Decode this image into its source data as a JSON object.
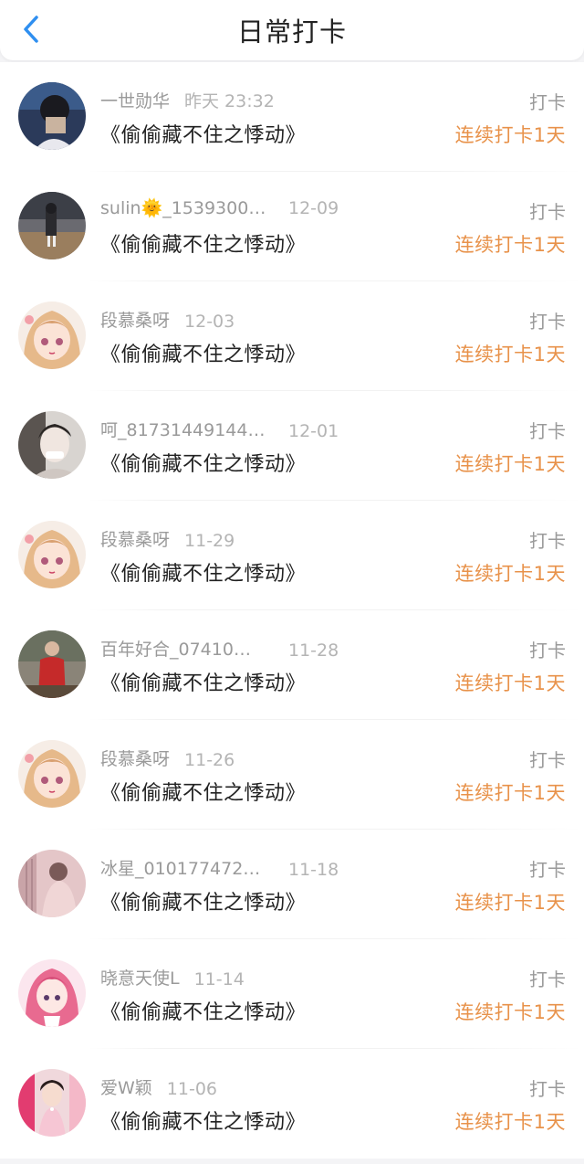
{
  "header": {
    "title": "日常打卡",
    "back_icon": "chevron-left-icon",
    "accent": "#2f8ff0"
  },
  "colors": {
    "streak": "#e8924a",
    "meta": "#9a9a9a",
    "text": "#222222"
  },
  "entries": [
    {
      "name": "一世勋华",
      "date": "昨天 23:32",
      "book": "《偷偷藏不住之悸动》",
      "action": "打卡",
      "streak": "连续打卡1天",
      "avatar": "avatar-photo-boy-icon"
    },
    {
      "name": "sulin🌞_1539300…",
      "date": "12-09",
      "book": "《偷偷藏不住之悸动》",
      "action": "打卡",
      "streak": "连续打卡1天",
      "avatar": "avatar-photo-street-icon"
    },
    {
      "name": "段慕桑呀",
      "date": "12-03",
      "book": "《偷偷藏不住之悸动》",
      "action": "打卡",
      "streak": "连续打卡1天",
      "avatar": "avatar-anime-girl-icon"
    },
    {
      "name": "呵_81731449144…",
      "date": "12-01",
      "book": "《偷偷藏不住之悸动》",
      "action": "打卡",
      "streak": "连续打卡1天",
      "avatar": "avatar-photo-girl-icon"
    },
    {
      "name": "段慕桑呀",
      "date": "11-29",
      "book": "《偷偷藏不住之悸动》",
      "action": "打卡",
      "streak": "连续打卡1天",
      "avatar": "avatar-anime-girl-icon"
    },
    {
      "name": "百年好合_07410…",
      "date": "11-28",
      "book": "《偷偷藏不住之悸动》",
      "action": "打卡",
      "streak": "连续打卡1天",
      "avatar": "avatar-photo-red-coat-icon"
    },
    {
      "name": "段慕桑呀",
      "date": "11-26",
      "book": "《偷偷藏不住之悸动》",
      "action": "打卡",
      "streak": "连续打卡1天",
      "avatar": "avatar-anime-girl-icon"
    },
    {
      "name": "冰星_010177472…",
      "date": "11-18",
      "book": "《偷偷藏不住之悸动》",
      "action": "打卡",
      "streak": "连续打卡1天",
      "avatar": "avatar-photo-pink-icon"
    },
    {
      "name": "晓意天使L",
      "date": "11-14",
      "book": "《偷偷藏不住之悸动》",
      "action": "打卡",
      "streak": "连续打卡1天",
      "avatar": "avatar-anime-pink-hair-icon"
    },
    {
      "name": "爱W颖",
      "date": "11-06",
      "book": "《偷偷藏不住之悸动》",
      "action": "打卡",
      "streak": "连续打卡1天",
      "avatar": "avatar-photo-pink-dress-icon"
    }
  ]
}
